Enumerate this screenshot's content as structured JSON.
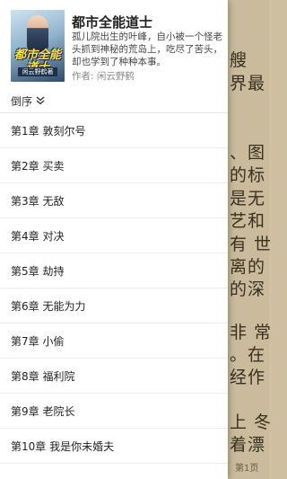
{
  "book": {
    "title": "都市全能道士",
    "description": "孤儿院出生的叶峰，自小被一个怪老头抓到神秘的荒岛上，吃尽了苦头，却也学到了种种本事。",
    "author": "作者: 闲云野鹤",
    "cover_title": "都市全能道士",
    "cover_author": "闲云野鹤著"
  },
  "sort": {
    "label": "倒序",
    "icon": "double-chevron-down-icon"
  },
  "chapters": [
    "第1章 敦刻尔号",
    "第2章 买卖",
    "第3章 无敌",
    "第4章 对决",
    "第5章 劫持",
    "第6章 无能为力",
    "第7章 小偷",
    "第8章 福利院",
    "第9章 老院长",
    "第10章 我是你未婚夫"
  ],
  "reader": {
    "lines": [
      "艘",
      "界最",
      "、图",
      "的标",
      "是无",
      "艺和",
      "有 世",
      "离的",
      "的深",
      "非 常",
      "。在",
      "经作",
      "上 冬",
      "着漂"
    ],
    "page_indicator": "第1页"
  },
  "colors": {
    "drawer_bg": "#ffffff",
    "reader_bg": "#c9bb9b",
    "divider": "#e6e6e6"
  }
}
